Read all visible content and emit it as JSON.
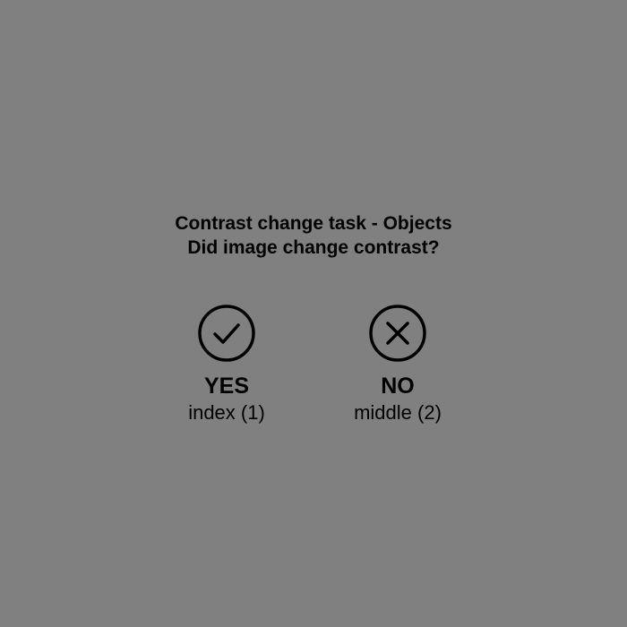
{
  "prompt": {
    "title": "Contrast change task - Objects",
    "question": "Did image change contrast?"
  },
  "options": [
    {
      "label": "YES",
      "key_hint": "index (1)",
      "icon": "check-circle-icon"
    },
    {
      "label": "NO",
      "key_hint": "middle (2)",
      "icon": "x-circle-icon"
    }
  ],
  "colors": {
    "background": "#808080",
    "foreground": "#000000"
  }
}
